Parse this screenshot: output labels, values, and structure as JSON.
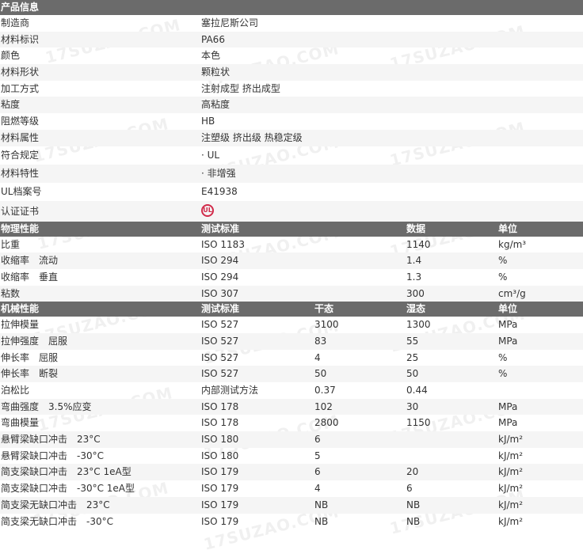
{
  "watermark": "17SUZAO.COM",
  "product": {
    "heading": "产品信息",
    "rows": [
      {
        "label": "制造商",
        "value": "塞拉尼斯公司"
      },
      {
        "label": "材料标识",
        "value": "PA66"
      },
      {
        "label": "颜色",
        "value": "本色"
      },
      {
        "label": "材料形状",
        "value": "颗粒状"
      },
      {
        "label": "加工方式",
        "value": "注射成型 挤出成型"
      },
      {
        "label": "粘度",
        "value": "高粘度"
      },
      {
        "label": "阻燃等级",
        "value": "HB"
      },
      {
        "label": "材料属性",
        "value": "注塑级 挤出级 热稳定级"
      },
      {
        "label": "符合规定",
        "value": "· UL"
      },
      {
        "label": "材料特性",
        "value": "· 非增强"
      },
      {
        "label": "UL档案号",
        "value": "E41938"
      }
    ],
    "cert_label": "认证证书",
    "cert_badge": "UL"
  },
  "physical": {
    "headers": [
      "物理性能",
      "测试标准",
      "数据",
      "单位"
    ],
    "rows": [
      [
        "比重",
        "ISO 1183",
        "1140",
        "kg/m³"
      ],
      [
        "收缩率　流动",
        "ISO 294",
        "1.4",
        "%"
      ],
      [
        "收缩率　垂直",
        "ISO 294",
        "1.3",
        "%"
      ],
      [
        "粘数",
        "ISO 307",
        "300",
        "cm³/g"
      ]
    ]
  },
  "mechanical": {
    "headers": [
      "机械性能",
      "测试标准",
      "干态",
      "湿态",
      "单位"
    ],
    "rows": [
      [
        "拉伸模量",
        "ISO 527",
        "3100",
        "1300",
        "MPa"
      ],
      [
        "拉伸强度　屈服",
        "ISO 527",
        "83",
        "55",
        "MPa"
      ],
      [
        "伸长率　屈服",
        "ISO 527",
        "4",
        "25",
        "%"
      ],
      [
        "伸长率　断裂",
        "ISO 527",
        "50",
        "50",
        "%"
      ],
      [
        "泊松比",
        "内部测试方法",
        "0.37",
        "0.44",
        ""
      ],
      [
        "弯曲强度　3.5%应变",
        "ISO 178",
        "102",
        "30",
        "MPa"
      ],
      [
        "弯曲模量",
        "ISO 178",
        "2800",
        "1150",
        "MPa"
      ],
      [
        "悬臂梁缺口冲击　23°C",
        "ISO 180",
        "6",
        "",
        "kJ/m²"
      ],
      [
        "悬臂梁缺口冲击　-30°C",
        "ISO 180",
        "5",
        "",
        "kJ/m²"
      ],
      [
        "简支梁缺口冲击　23°C 1eA型",
        "ISO 179",
        "6",
        "20",
        "kJ/m²"
      ],
      [
        "简支梁缺口冲击　-30°C 1eA型",
        "ISO 179",
        "4",
        "6",
        "kJ/m²"
      ],
      [
        "简支梁无缺口冲击　23°C",
        "ISO 179",
        "NB",
        "NB",
        "kJ/m²"
      ],
      [
        "简支梁无缺口冲击　-30°C",
        "ISO 179",
        "NB",
        "NB",
        "kJ/m²"
      ]
    ]
  }
}
